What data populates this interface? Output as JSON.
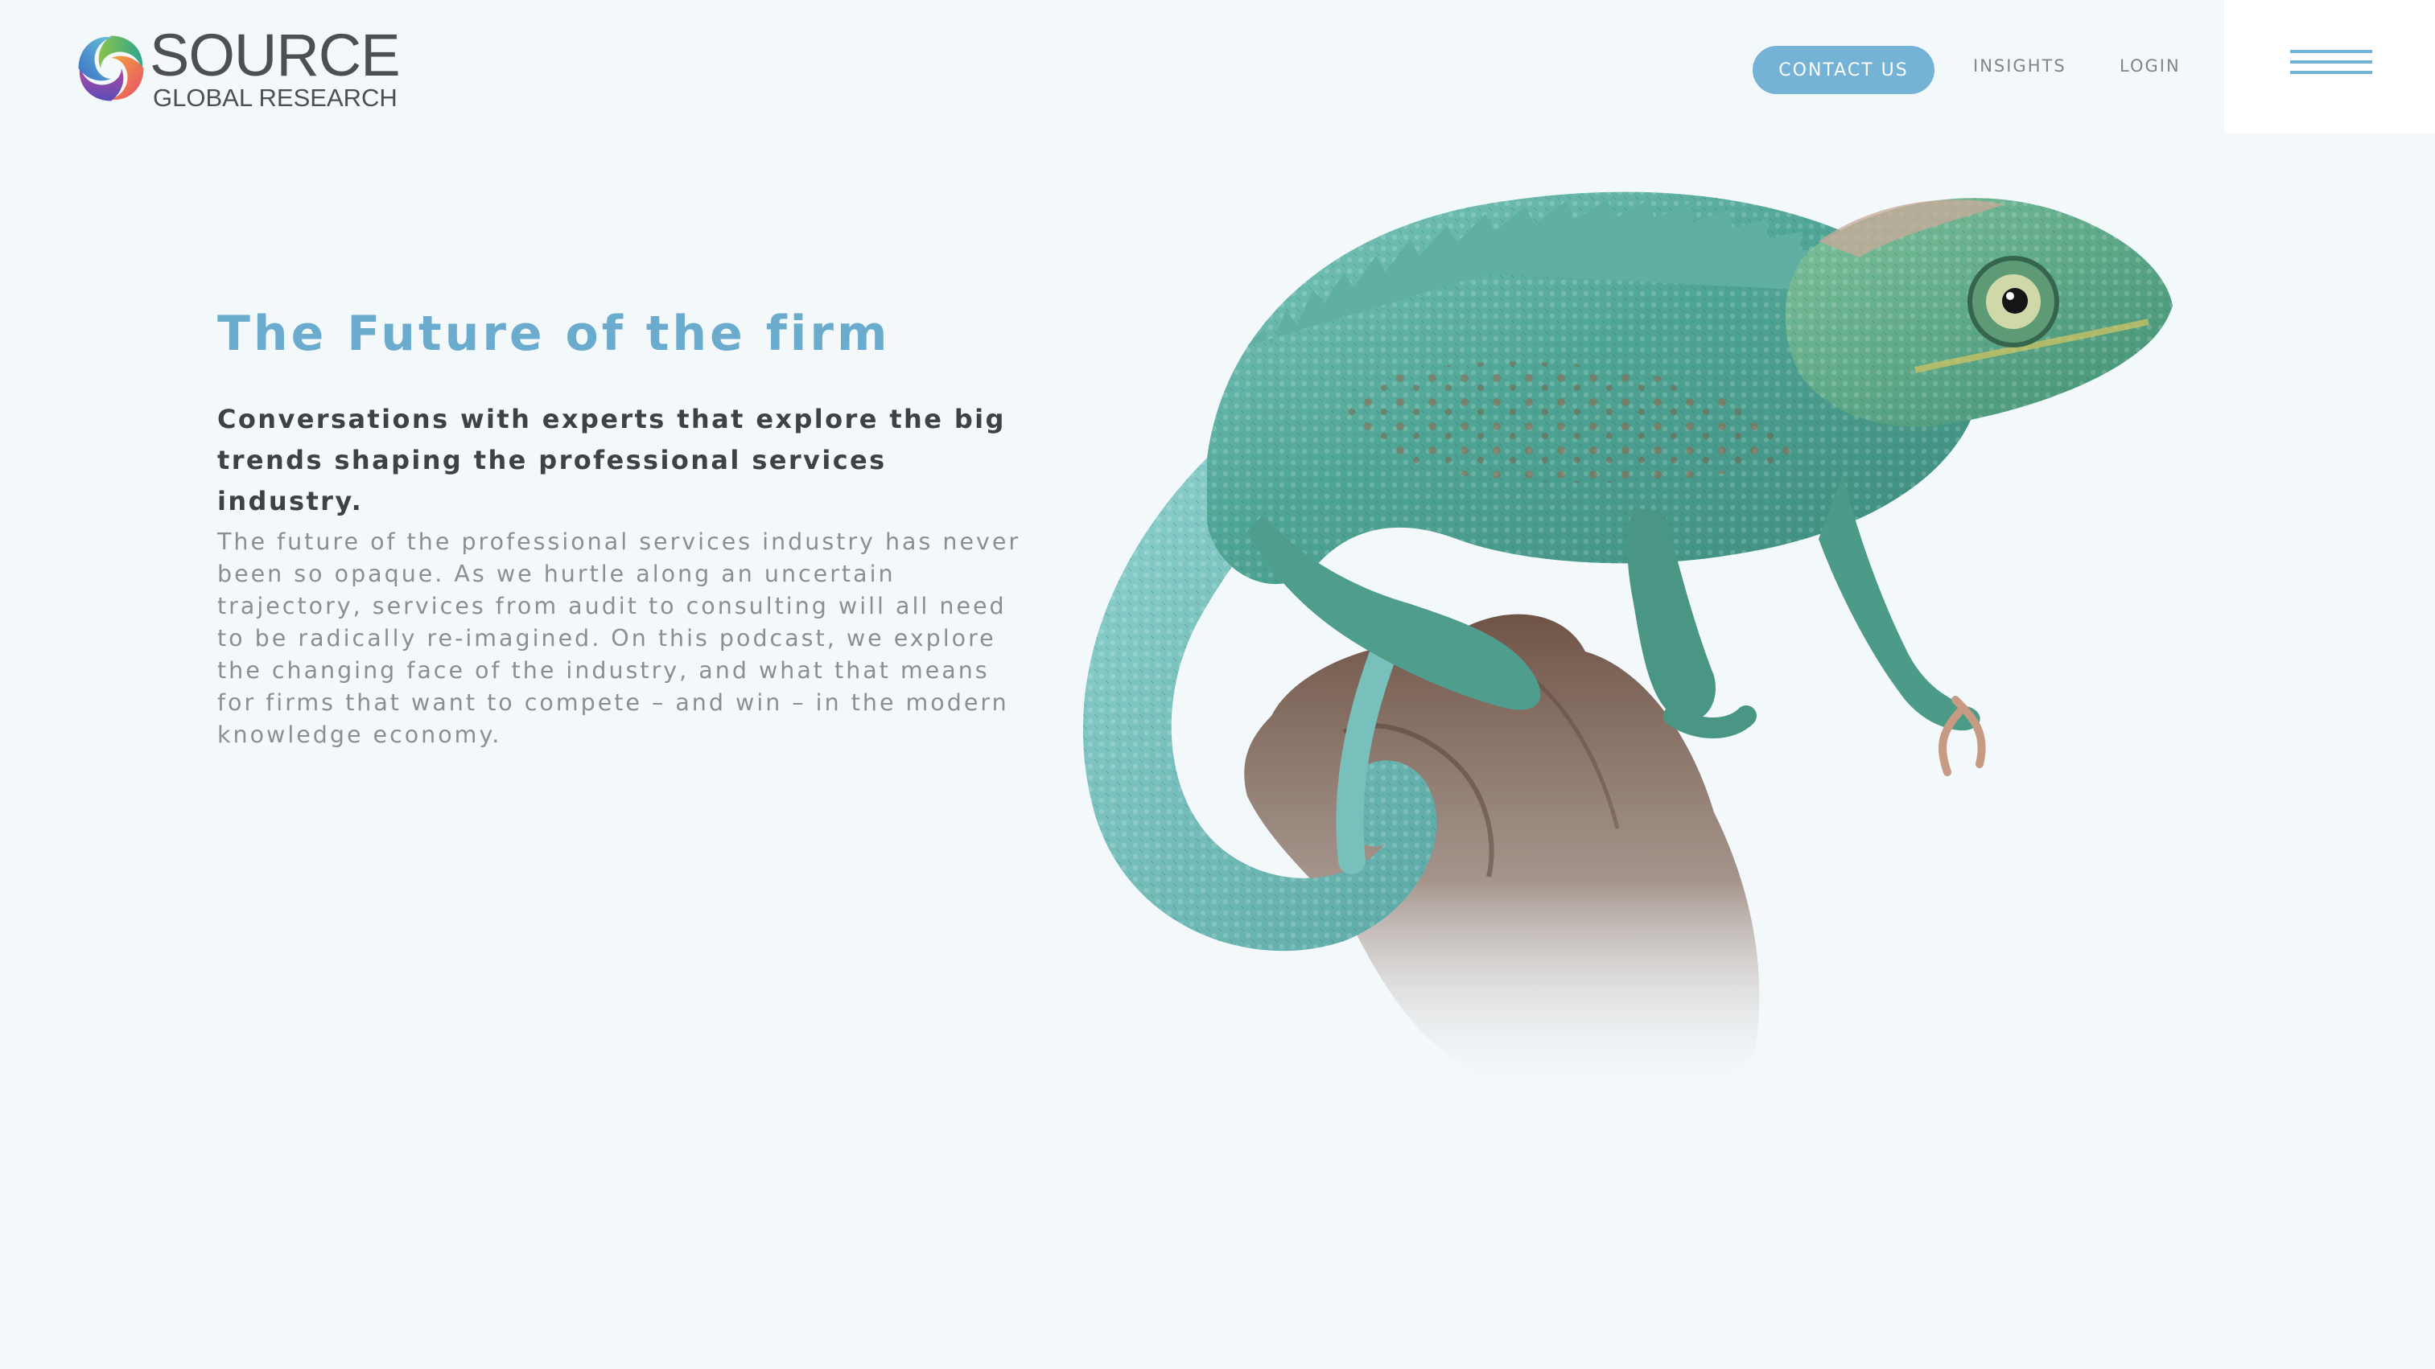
{
  "header": {
    "logo": {
      "primary": "SOURCE",
      "secondary": "GLOBAL RESEARCH"
    },
    "nav": {
      "contact_label": "CONTACT US",
      "insights_label": "INSIGHTS",
      "login_label": "LOGIN"
    },
    "menu_icon": "hamburger-menu-icon"
  },
  "hero": {
    "title": "The Future of the firm",
    "subtitle": "Conversations with experts that explore the big trends shaping the professional services industry.",
    "body": "The future of the professional services industry has never been so opaque. As we hurtle along an uncertain trajectory, services from audit to consulting will all need to be radically re-imagined. On this podcast, we explore the changing face of the industry, and what that means for firms that want to compete – and win – in the modern knowledge economy."
  },
  "colors": {
    "background": "#f3f8fb",
    "accent": "#74b3d5",
    "title": "#6aabce",
    "subtitle": "#3f4144",
    "body": "#8b8f93",
    "nav": "#7e858b"
  }
}
